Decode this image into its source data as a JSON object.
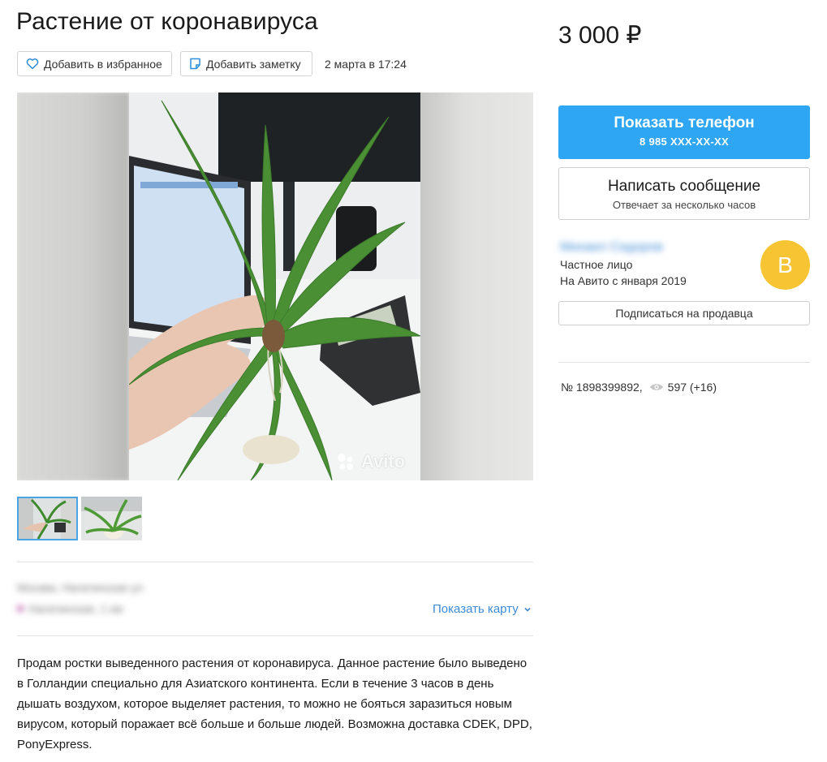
{
  "listing": {
    "title": "Растение от коронавируса",
    "price": "3 000 ₽",
    "date": "2 марта в 17:24",
    "favorite_label": "Добавить в избранное",
    "note_label": "Добавить заметку",
    "watermark": "Avito",
    "description": "Продам ростки выведенного растения от коронавируса. Данное растение было выведено в Голландии специально для Азиатского континента. Если в течение 3 часов в день дышать воздухом, которое выделяет растения, то можно не бояться заразиться новым вирусом, который поражает всё больше и больше людей. Возможна доставка CDEK, DPD, PonyExpress.",
    "show_map": "Показать карту",
    "address_blurred": "Москва, Нагатинская ул",
    "metro_blurred": "Нагатинская, 1 км",
    "item_number": "№ 1898399892,",
    "views": "597 (+16)"
  },
  "contact": {
    "phone_button": "Показать телефон",
    "phone_number": "8 985 XXX-XX-XX",
    "message_button": "Написать сообщение",
    "message_hint": "Отвечает за несколько часов",
    "subscribe_button": "Подписаться на продавца"
  },
  "seller": {
    "name_blurred": "Михаил Сидоров",
    "type": "Частное лицо",
    "since": "На Авито с января 2019",
    "avatar_letter": "В"
  },
  "colors": {
    "accent": "#2ea6f4",
    "link": "#3e8ad4",
    "avatar": "#f7c534"
  },
  "icons": [
    "heart-icon",
    "note-icon",
    "eye-icon",
    "chevron-down-icon",
    "avito-logo-icon"
  ]
}
